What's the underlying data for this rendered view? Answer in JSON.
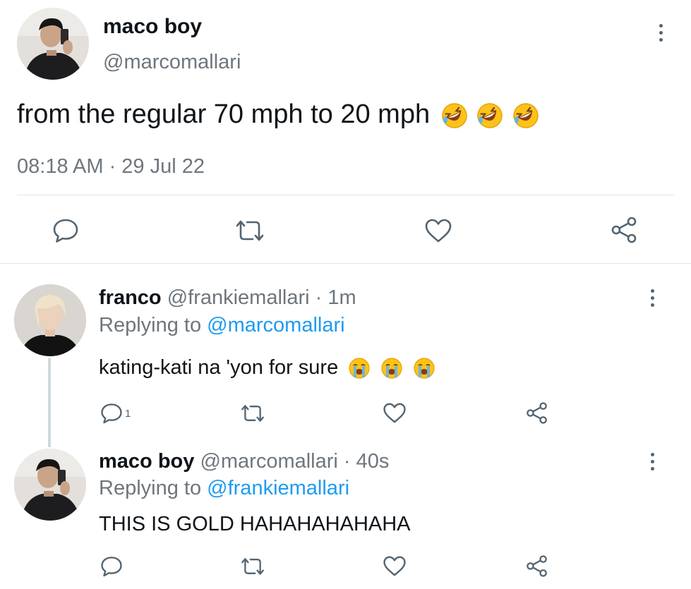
{
  "main_tweet": {
    "display_name": "maco boy",
    "handle": "@marcomallari",
    "text": "from the regular 70 mph to 20 mph",
    "emoji": [
      "rolling-on-floor-laughing",
      "rolling-on-floor-laughing",
      "rolling-on-floor-laughing"
    ],
    "timestamp": "08:18 AM · 29 Jul 22"
  },
  "replies": [
    {
      "display_name": "franco",
      "handle": "@frankiemallari",
      "time": "· 1m",
      "replying_label": "Replying to",
      "replying_to": "@marcomallari",
      "text": "kating-kati na 'yon for sure",
      "emoji": [
        "loudly-crying-face",
        "loudly-crying-face",
        "loudly-crying-face"
      ],
      "reply_count": "1"
    },
    {
      "display_name": "maco boy",
      "handle": "@marcomallari",
      "time": "· 40s",
      "replying_label": "Replying to",
      "replying_to": "@frankiemallari",
      "text": "THIS IS GOLD HAHAHAHAHAHA",
      "reply_count": ""
    }
  ],
  "icons": {
    "reply": "speech-bubble-icon",
    "retweet": "retweet-icon",
    "like": "heart-icon",
    "share": "share-icon",
    "more": "more-vertical-icon"
  },
  "colors": {
    "link": "#1d9bf0",
    "muted": "#6e767d",
    "icon": "#536471",
    "text": "#0f1419"
  }
}
